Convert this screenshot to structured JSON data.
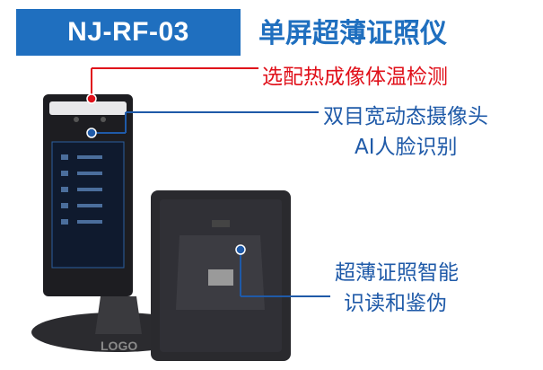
{
  "product": {
    "model": "NJ-RF-03",
    "name": "单屏超薄证照仪"
  },
  "features": {
    "thermal": "选配热成像体温检测",
    "camera_line1": "双目宽动态摄像头",
    "camera_line2": "AI人脸识别",
    "document_line1": "超薄证照智能",
    "document_line2": "识读和鉴伪"
  },
  "device": {
    "base_logo": "LOGO"
  },
  "colors": {
    "brand_blue": "#1f6fbf",
    "highlight_red": "#e0101a",
    "feature_blue": "#1f5aa8",
    "device_dark": "#2a2a2e"
  }
}
